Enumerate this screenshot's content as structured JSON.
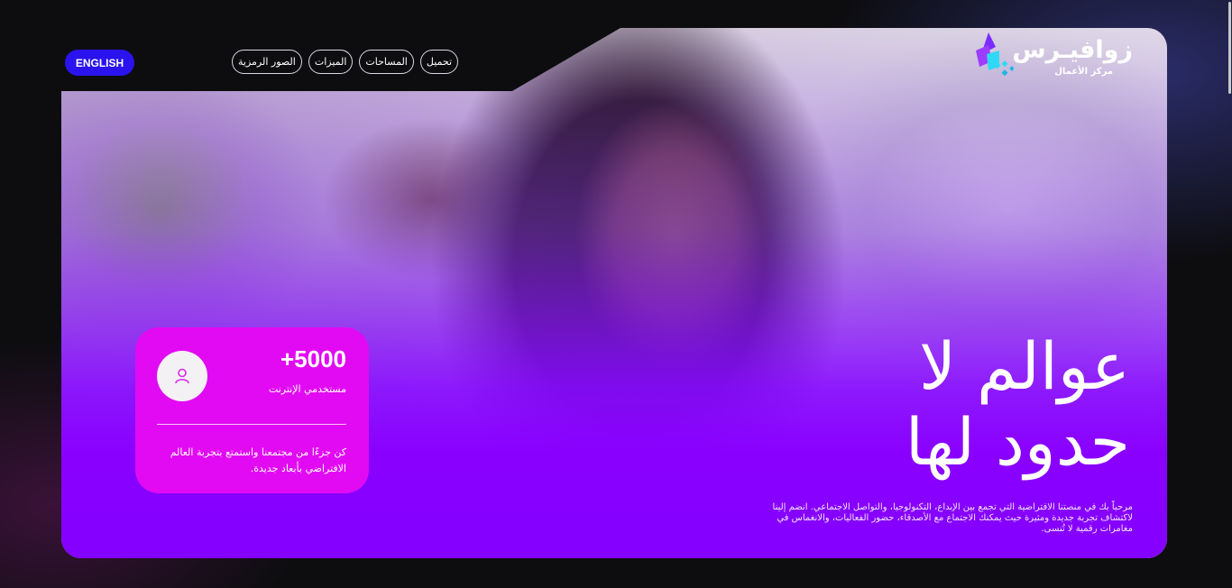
{
  "brand": {
    "name": "زوافيـرس",
    "subtitle": "مركز الأعمال",
    "icon": "diamond-stack-logo",
    "colors": {
      "purple": "#8a00ff",
      "magenta": "#e20af3",
      "blue": "#2a13ee",
      "cyan": "#2fd9f5"
    }
  },
  "header": {
    "language_button": "ENGLISH",
    "nav": [
      "تحميل",
      "الميزات",
      "الصور الرمزية",
      "المساحات"
    ]
  },
  "hero": {
    "headline_line1": "عوالم لا",
    "headline_line2": "حدود لها",
    "intro": "مرحباً بك في منصتنا الافتراضية التي تجمع بين الإبداع، التكنولوجيا، والتواصل الاجتماعي. انضم إلينا لاكتشاف تجربة جديدة ومثيرة حيث يمكنك الاجتماع مع الأصدقاء، حضور الفعاليات، والانغماس في مغامرات رقمية لا تُنسى."
  },
  "stats_card": {
    "icon": "user-icon",
    "value": "+5000",
    "label": "مستخدمي الإنترنت",
    "description": "كن جزءًا من مجتمعنا واستمتع بتجربة العالم الافتراضي بأبعاد جديدة."
  }
}
